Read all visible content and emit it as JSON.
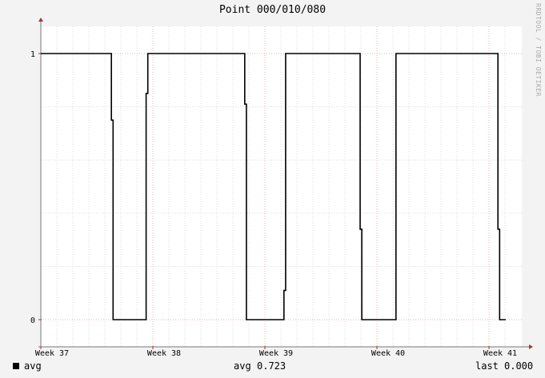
{
  "chart_data": {
    "type": "line",
    "title": "Point 000/010/080",
    "xlabel": "",
    "ylabel": "",
    "watermark": "RRDTOOL / TOBI OETIKER",
    "x_tick_labels": [
      "Week 37",
      "Week 38",
      "Week 39",
      "Week 40",
      "Week 41"
    ],
    "x_ticks": [
      0,
      1,
      2,
      3,
      4
    ],
    "xlim": [
      0,
      4.15
    ],
    "y_tick_labels": [
      "0",
      "1"
    ],
    "y_ticks": [
      0,
      1
    ],
    "ylim": [
      -0.1,
      1.1
    ],
    "grid": true,
    "legend_position": "bottom",
    "series": [
      {
        "name": "avg",
        "color": "#000000",
        "points": [
          [
            0.0,
            1
          ],
          [
            0.63,
            1
          ],
          [
            0.63,
            0.75
          ],
          [
            0.645,
            0.75
          ],
          [
            0.645,
            0
          ],
          [
            0.94,
            0
          ],
          [
            0.94,
            0.85
          ],
          [
            0.955,
            0.85
          ],
          [
            0.955,
            1
          ],
          [
            1.82,
            1
          ],
          [
            1.82,
            0.81
          ],
          [
            1.835,
            0.81
          ],
          [
            1.835,
            0
          ],
          [
            2.17,
            0
          ],
          [
            2.17,
            0.11
          ],
          [
            2.185,
            0.11
          ],
          [
            2.185,
            1
          ],
          [
            2.85,
            1
          ],
          [
            2.85,
            0.34
          ],
          [
            2.865,
            0.34
          ],
          [
            2.865,
            0
          ],
          [
            3.17,
            0
          ],
          [
            3.17,
            1
          ],
          [
            4.08,
            1
          ],
          [
            4.08,
            0.34
          ],
          [
            4.095,
            0.34
          ],
          [
            4.095,
            0
          ],
          [
            4.15,
            0
          ]
        ]
      }
    ]
  },
  "legend": {
    "name": "avg",
    "avg_label": "avg",
    "avg_value": "0.723",
    "last_label": "last",
    "last_value": "0.000"
  }
}
